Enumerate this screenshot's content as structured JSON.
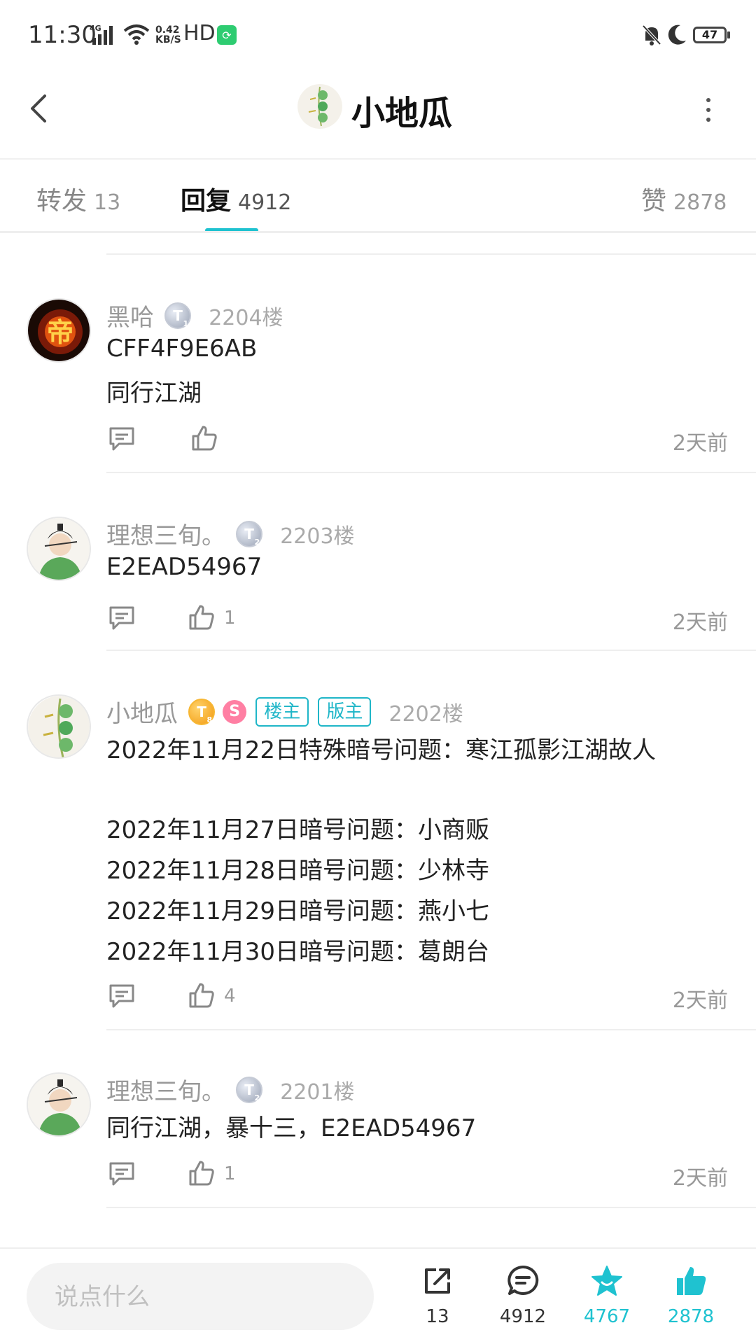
{
  "status_bar": {
    "time": "11:30",
    "network": "4G",
    "speed_value": "0.42",
    "speed_unit": "KB/S",
    "hd": "HD",
    "battery": "47"
  },
  "header": {
    "title": "小地瓜"
  },
  "tabs": [
    {
      "label": "转发",
      "count": "13"
    },
    {
      "label": "回复",
      "count": "4912"
    },
    {
      "label": "赞",
      "count": "2878"
    }
  ],
  "posts": [
    {
      "username": "黑哈",
      "level": "T",
      "level_num": "1",
      "floor": "2204楼",
      "lines": [
        "CFF4F9E6AB",
        "同行江湖"
      ],
      "like_count": "",
      "time": "2天前"
    },
    {
      "username": "理想三旬。",
      "level": "T",
      "level_num": "2",
      "floor": "2203楼",
      "lines": [
        "E2EAD54967"
      ],
      "like_count": "1",
      "time": "2天前"
    },
    {
      "username": "小地瓜",
      "level": "T",
      "level_num": "8",
      "badge": "S",
      "tags": [
        "楼主",
        "版主"
      ],
      "floor": "2202楼",
      "lines": [
        "2022年11月22日特殊暗号问题：寒江孤影江湖故人",
        "",
        "2022年11月27日暗号问题：小商贩",
        "2022年11月28日暗号问题：少林寺",
        "2022年11月29日暗号问题：燕小七",
        "2022年11月30日暗号问题：葛朗台"
      ],
      "like_count": "4",
      "time": "2天前"
    },
    {
      "username": "理想三旬。",
      "level": "T",
      "level_num": "2",
      "floor": "2201楼",
      "lines": [
        "同行江湖，暴十三，E2EAD54967"
      ],
      "like_count": "1",
      "time": "2天前"
    }
  ],
  "bottom_bar": {
    "input_placeholder": "说点什么",
    "share_count": "13",
    "comment_count": "4912",
    "favorite_count": "4767",
    "like_count": "2878"
  },
  "colors": {
    "accent": "#1fc2d0",
    "muted": "#999999"
  },
  "icons": [
    "back-arrow-icon",
    "more-vertical-icon",
    "comment-icon",
    "thumb-up-icon",
    "share-icon",
    "star-icon",
    "bell-off-icon",
    "moon-icon",
    "wifi-icon",
    "signal-icon"
  ]
}
